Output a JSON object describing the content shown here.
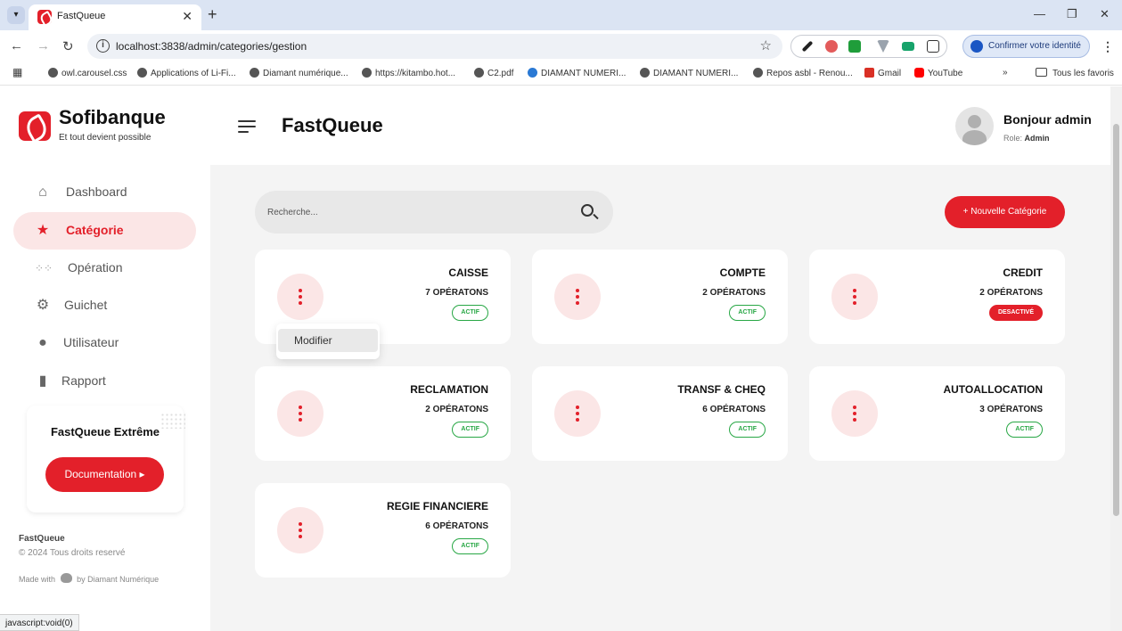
{
  "browser": {
    "tab_title": "FastQueue",
    "url": "localhost:3838/admin/categories/gestion",
    "identity_button": "Confirmer votre identité",
    "bookmarks": [
      "owl.carousel.css",
      "Applications of Li-Fi...",
      "Diamant numérique...",
      "https://kitambo.hot...",
      "C2.pdf",
      "DIAMANT NUMERI...",
      "DIAMANT NUMERI...",
      "Repos asbl - Renou...",
      "Gmail",
      "YouTube"
    ],
    "bookmarks_more": "»",
    "all_bookmarks": "Tous les favoris",
    "status_text": "javascript:void(0)"
  },
  "sidebar": {
    "brand": "Sofibanque",
    "tagline": "Et tout devient possible",
    "items": [
      {
        "label": "Dashboard",
        "icon": "home-icon",
        "active": false
      },
      {
        "label": "Catégorie",
        "icon": "star-icon",
        "active": true
      },
      {
        "label": "Opération",
        "icon": "grid-icon",
        "active": false
      },
      {
        "label": "Guichet",
        "icon": "gear-icon",
        "active": false
      },
      {
        "label": "Utilisateur",
        "icon": "user-icon",
        "active": false
      },
      {
        "label": "Rapport",
        "icon": "document-icon",
        "active": false
      }
    ],
    "promo_title": "FastQueue Extrême",
    "doc_button": "Documentation ▸",
    "footer_brand": "FastQueue",
    "footer_copy": "© 2024 Tous droits reservé",
    "footer_made_prefix": "Made with",
    "footer_made_suffix": "by Diamant Numérique"
  },
  "header": {
    "title": "FastQueue",
    "greeting": "Bonjour admin",
    "role_label": "Role:",
    "role_value": "Admin"
  },
  "main": {
    "search_placeholder": "Recherche...",
    "add_button": "+ Nouvelle Catégorie",
    "dropdown_item": "Modifier",
    "categories": [
      {
        "name": "CAISSE",
        "operations": "7 OPÉRATONS",
        "status": "ACTIF"
      },
      {
        "name": "COMPTE",
        "operations": "2 OPÉRATONS",
        "status": "ACTIF"
      },
      {
        "name": "CREDIT",
        "operations": "2 OPÉRATONS",
        "status": "DESACTIVÉ"
      },
      {
        "name": "RECLAMATION",
        "operations": "2 OPÉRATONS",
        "status": "ACTIF"
      },
      {
        "name": "TRANSF & CHEQ",
        "operations": "6 OPÉRATONS",
        "status": "ACTIF"
      },
      {
        "name": "AUTOALLOCATION",
        "operations": "3 OPÉRATONS",
        "status": "ACTIF"
      },
      {
        "name": "REGIE FINANCIERE",
        "operations": "6 OPÉRATONS",
        "status": "ACTIF"
      }
    ]
  },
  "colors": {
    "accent": "#e3202a",
    "active_bg": "#fbe6e6",
    "success": "#28a745"
  }
}
